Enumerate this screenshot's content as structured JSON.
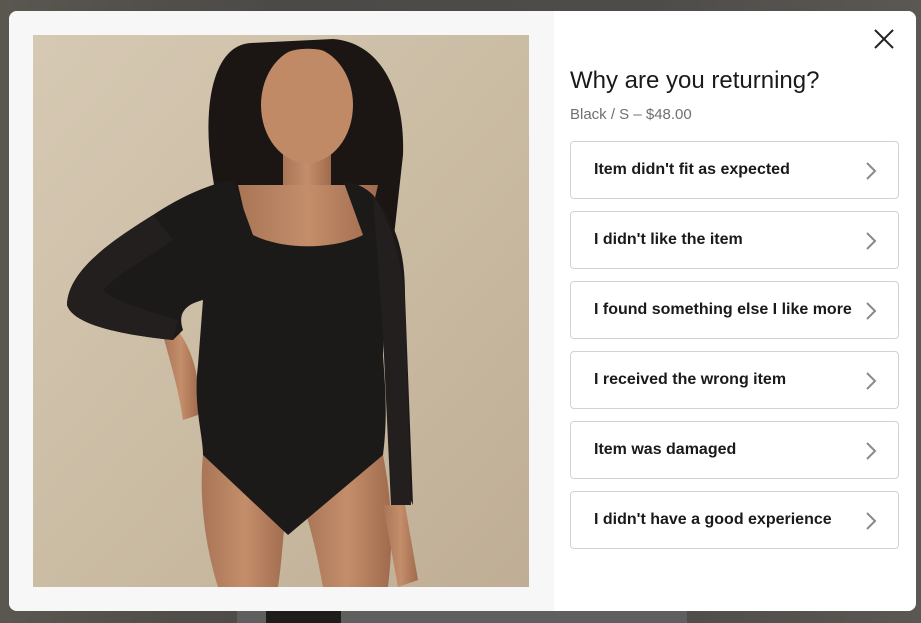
{
  "modal": {
    "title": "Why are you returning?",
    "variant": "Black / S – $48.00",
    "close_icon": "close-icon",
    "chevron_icon": "chevron-right-icon",
    "image_alt": "Model wearing black long-sleeve ribbed bodysuit",
    "reasons": [
      {
        "label": "Item didn't fit as expected"
      },
      {
        "label": "I didn't like the item"
      },
      {
        "label": "I found something else I like more"
      },
      {
        "label": "I received the wrong item"
      },
      {
        "label": "Item was damaged"
      },
      {
        "label": "I didn't have a good experience"
      }
    ]
  },
  "colors": {
    "overlay": "#4a4a4a",
    "border": "#d3d3d3",
    "text": "#1a1a1a",
    "muted": "#707070",
    "product": "#1c1a19"
  }
}
